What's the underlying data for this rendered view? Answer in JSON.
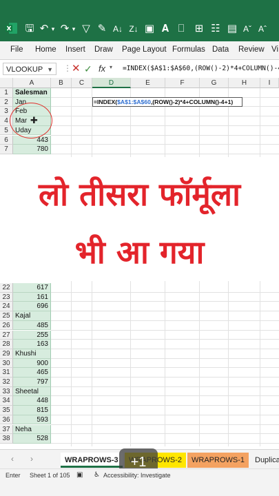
{
  "titlebar": {
    "accent": "#1e7145",
    "icons": [
      "excel-logo-icon",
      "save-icon",
      "undo-icon",
      "undo-dropdown-icon",
      "redo-icon",
      "redo-dropdown-icon",
      "filter-icon",
      "format-painter-icon",
      "sort-asc-icon",
      "sort-desc-icon",
      "fill-color-icon",
      "print-preview-icon",
      "grid-icon",
      "more-icon",
      "font-grow-icon"
    ]
  },
  "ribbon": {
    "tabs": [
      "File",
      "Home",
      "Insert",
      "Draw",
      "Page Layout",
      "Formulas",
      "Data",
      "Review",
      "Vi"
    ]
  },
  "formula_bar": {
    "name_box": "VLOOKUP",
    "fx_label": "fx",
    "formula": "=INDEX($A$1:$A$60,(ROW()-2)*4+COLUMN()-4+1)"
  },
  "grid": {
    "columns": [
      "A",
      "B",
      "C",
      "D",
      "E",
      "F",
      "G",
      "H",
      "I"
    ],
    "active_column": "D",
    "top_rows": [
      {
        "row": "1",
        "a": "Salesman",
        "bold": true
      },
      {
        "row": "2",
        "a": "Jan"
      },
      {
        "row": "3",
        "a": "Feb"
      },
      {
        "row": "4",
        "a": "Mar"
      },
      {
        "row": "5",
        "a": "Uday"
      },
      {
        "row": "6",
        "a": "443",
        "num": true
      },
      {
        "row": "7",
        "a": "780",
        "num": true
      }
    ],
    "editing_cell": {
      "prefix": "=INDEX(",
      "ref": "$A$1:$A$60",
      "middle": ",(ROW()-2)*4+COLUMN()-4+1)"
    },
    "bottom_rows": [
      {
        "row": "22",
        "a": "617",
        "num": true
      },
      {
        "row": "23",
        "a": "161",
        "num": true
      },
      {
        "row": "24",
        "a": "696",
        "num": true
      },
      {
        "row": "25",
        "a": "Kajal"
      },
      {
        "row": "26",
        "a": "485",
        "num": true
      },
      {
        "row": "27",
        "a": "255",
        "num": true
      },
      {
        "row": "28",
        "a": "163",
        "num": true
      },
      {
        "row": "29",
        "a": "Khushi"
      },
      {
        "row": "30",
        "a": "900",
        "num": true
      },
      {
        "row": "31",
        "a": "465",
        "num": true
      },
      {
        "row": "32",
        "a": "797",
        "num": true
      },
      {
        "row": "33",
        "a": "Sheetal"
      },
      {
        "row": "34",
        "a": "448",
        "num": true
      },
      {
        "row": "35",
        "a": "815",
        "num": true
      },
      {
        "row": "36",
        "a": "593",
        "num": true
      },
      {
        "row": "37",
        "a": "Neha"
      },
      {
        "row": "38",
        "a": "528",
        "num": true
      }
    ]
  },
  "overlay": {
    "line1": "लो तीसरा फॉर्मूला",
    "line2": "भी आ गया",
    "color": "#e3242b"
  },
  "sheet_tabs": {
    "tabs": [
      {
        "label": "WRAPROWS-3",
        "active": true,
        "color": "#ffffff"
      },
      {
        "label": "WRAPROWS-2",
        "active": false,
        "color": "#ffe600"
      },
      {
        "label": "WRAPROWS-1",
        "active": false,
        "color": "#f4a261"
      },
      {
        "label": "Duplica",
        "active": false,
        "color": "#f3f3f3"
      }
    ],
    "badge": "+1"
  },
  "status_bar": {
    "mode": "Enter",
    "sheet_info": "Sheet 1 of 105",
    "accessibility": "Accessibility: Investigate"
  }
}
